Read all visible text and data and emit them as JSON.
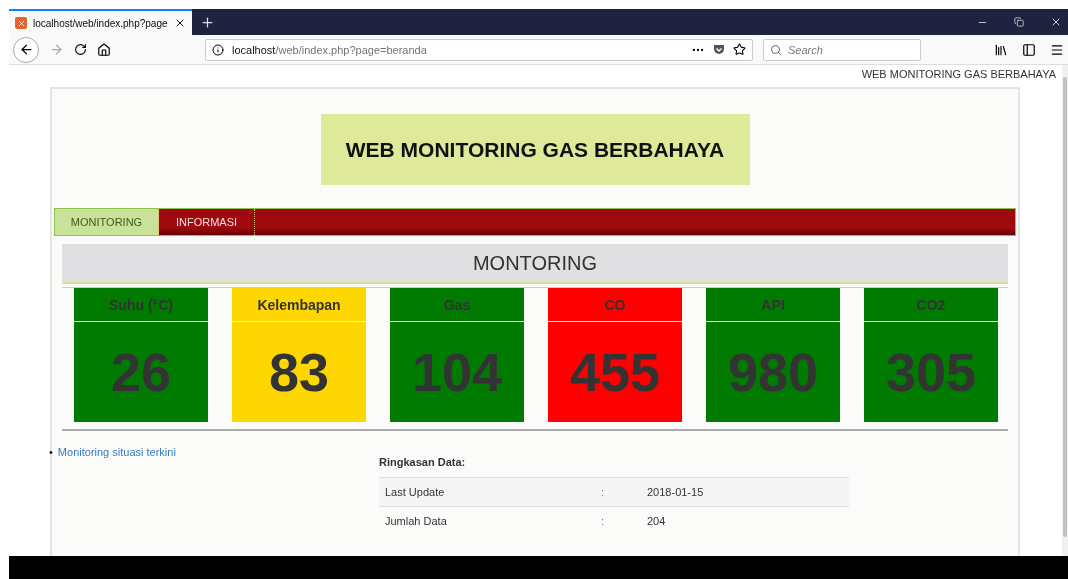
{
  "browser": {
    "tab_title": "localhost/web/index.php?page",
    "url_host": "localhost",
    "url_path": "/web/index.php?page=beranda",
    "search": {
      "placeholder": "Search"
    }
  },
  "header_text": "WEB MONITORING GAS BERBAHAYA",
  "title": "WEB MONITORING GAS BERBAHAYA",
  "nav": [
    {
      "label": "MONITORING",
      "selected": true
    },
    {
      "label": "INFORMASI",
      "selected": false
    }
  ],
  "section_title": "MONTORING",
  "sensors": [
    {
      "label": "Suhu (°C)",
      "value": "26",
      "color": "#007a00"
    },
    {
      "label": "Kelembapan",
      "value": "83",
      "color": "#ffd700"
    },
    {
      "label": "Gas",
      "value": "104",
      "color": "#007a00"
    },
    {
      "label": "CO",
      "value": "455",
      "color": "#ff0000"
    },
    {
      "label": "API",
      "value": "980",
      "color": "#007a00"
    },
    {
      "label": "CO2",
      "value": "305",
      "color": "#007a00"
    }
  ],
  "links": [
    {
      "marker": "•",
      "text": "Monitoring situasi terkini"
    }
  ],
  "summary": {
    "title": "Ringkasan Data:",
    "rows": [
      {
        "label": "Last Update",
        "separator": ":",
        "value": "2018-01-15"
      },
      {
        "label": "Jumlah Data",
        "separator": ":",
        "value": "204"
      }
    ]
  }
}
